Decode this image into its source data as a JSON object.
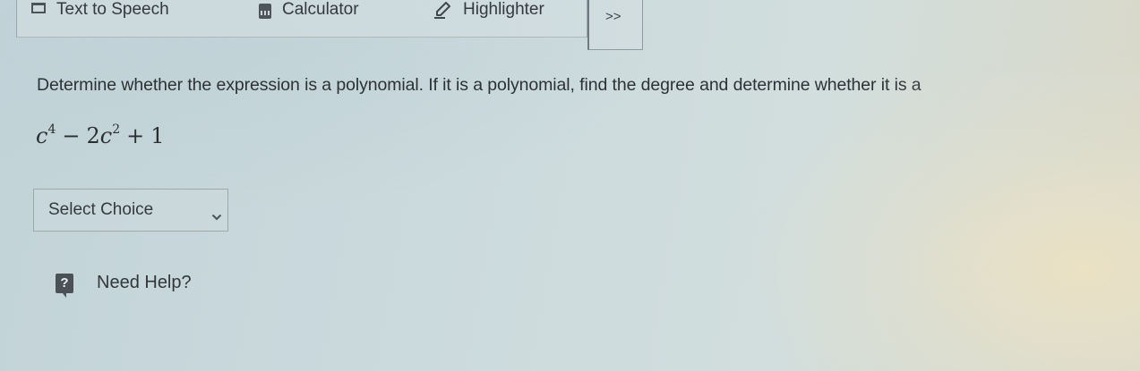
{
  "toolbar": {
    "tools": [
      {
        "label": "Text to Speech",
        "icon": "text-to-speech-icon"
      },
      {
        "label": "Calculator",
        "icon": "calculator-icon"
      },
      {
        "label": "Highlighter",
        "icon": "highlighter-icon"
      }
    ],
    "more_label": ">>"
  },
  "question": {
    "prompt": "Determine whether the expression is a polynomial. If it is a polynomial, find the degree and determine whether it is a",
    "expression": {
      "term1_var": "c",
      "term1_exp": "4",
      "op1": "−",
      "term2_coef": "2",
      "term2_var": "c",
      "term2_exp": "2",
      "op2": "+",
      "term3": "1"
    }
  },
  "select": {
    "selected": "Select Choice"
  },
  "help": {
    "icon_text": "?",
    "label": "Need Help?"
  }
}
